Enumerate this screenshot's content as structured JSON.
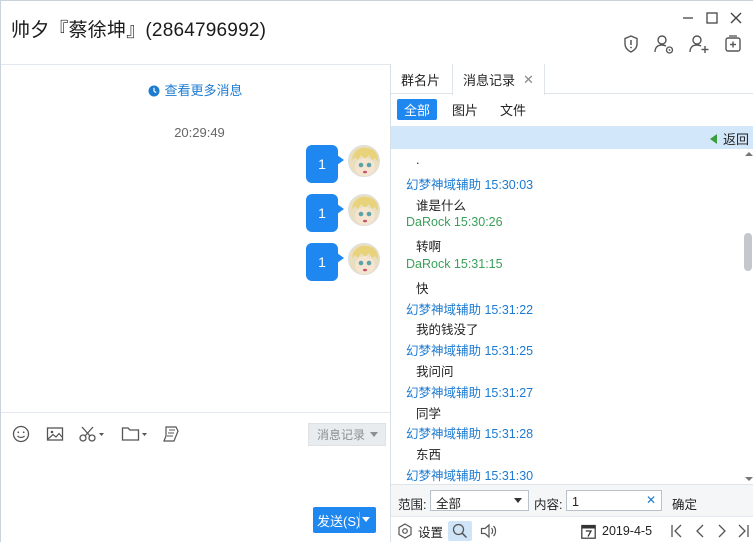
{
  "window": {
    "title": "帅夕『蔡徐坤』(2864796992)"
  },
  "titlebar_icons": [
    "shield-icon",
    "group-settings-icon",
    "add-member-icon",
    "add-app-icon"
  ],
  "chat": {
    "more_messages": "查看更多消息",
    "timestamp": "20:29:49",
    "messages": [
      {
        "text": "1"
      },
      {
        "text": "1"
      },
      {
        "text": "1"
      }
    ]
  },
  "input_toolbar": {
    "icons": [
      "emoji-icon",
      "image-icon",
      "screenshot-scissors-icon",
      "folder-icon",
      "ticket-icon"
    ],
    "history_label": "消息记录",
    "send_label": "发送(S)"
  },
  "right_panel": {
    "tabs": [
      {
        "label": "群名片"
      },
      {
        "label": "消息记录"
      }
    ],
    "filters": [
      {
        "label": "全部",
        "active": true
      },
      {
        "label": "图片",
        "active": false
      },
      {
        "label": "文件",
        "active": false
      }
    ],
    "back_label": "返回",
    "log": [
      {
        "kind": "text",
        "value": "."
      },
      {
        "kind": "sender",
        "color": "blue",
        "value": "幻梦神域辅助 15:30:03"
      },
      {
        "kind": "text",
        "value": "谁是什么"
      },
      {
        "kind": "sender",
        "color": "green",
        "value": "DaRock 15:30:26"
      },
      {
        "kind": "text",
        "value": "转啊"
      },
      {
        "kind": "sender",
        "color": "green",
        "value": "DaRock 15:31:15"
      },
      {
        "kind": "text",
        "value": "快"
      },
      {
        "kind": "sender",
        "color": "blue",
        "value": "幻梦神域辅助 15:31:22"
      },
      {
        "kind": "text",
        "value": "我的钱没了"
      },
      {
        "kind": "sender",
        "color": "blue",
        "value": "幻梦神域辅助 15:31:25"
      },
      {
        "kind": "text",
        "value": "我问问"
      },
      {
        "kind": "sender",
        "color": "blue",
        "value": "幻梦神域辅助 15:31:27"
      },
      {
        "kind": "text",
        "value": "同学"
      },
      {
        "kind": "sender",
        "color": "blue",
        "value": "幻梦神域辅助 15:31:28"
      },
      {
        "kind": "text",
        "value": "东西"
      },
      {
        "kind": "sender",
        "color": "blue",
        "value": "幻梦神域辅助 15:31:30"
      }
    ],
    "search": {
      "range_label": "范围:",
      "range_value": "全部",
      "content_label": "内容:",
      "content_value": "1",
      "confirm_label": "确定"
    },
    "bottom": {
      "settings_label": "设置",
      "date": "2019-4-5"
    }
  },
  "colors": {
    "accent": "#1e87f0",
    "sender_blue": "#1d7bd1",
    "sender_green": "#3aa05a",
    "back_bar": "#d3e7fb"
  }
}
